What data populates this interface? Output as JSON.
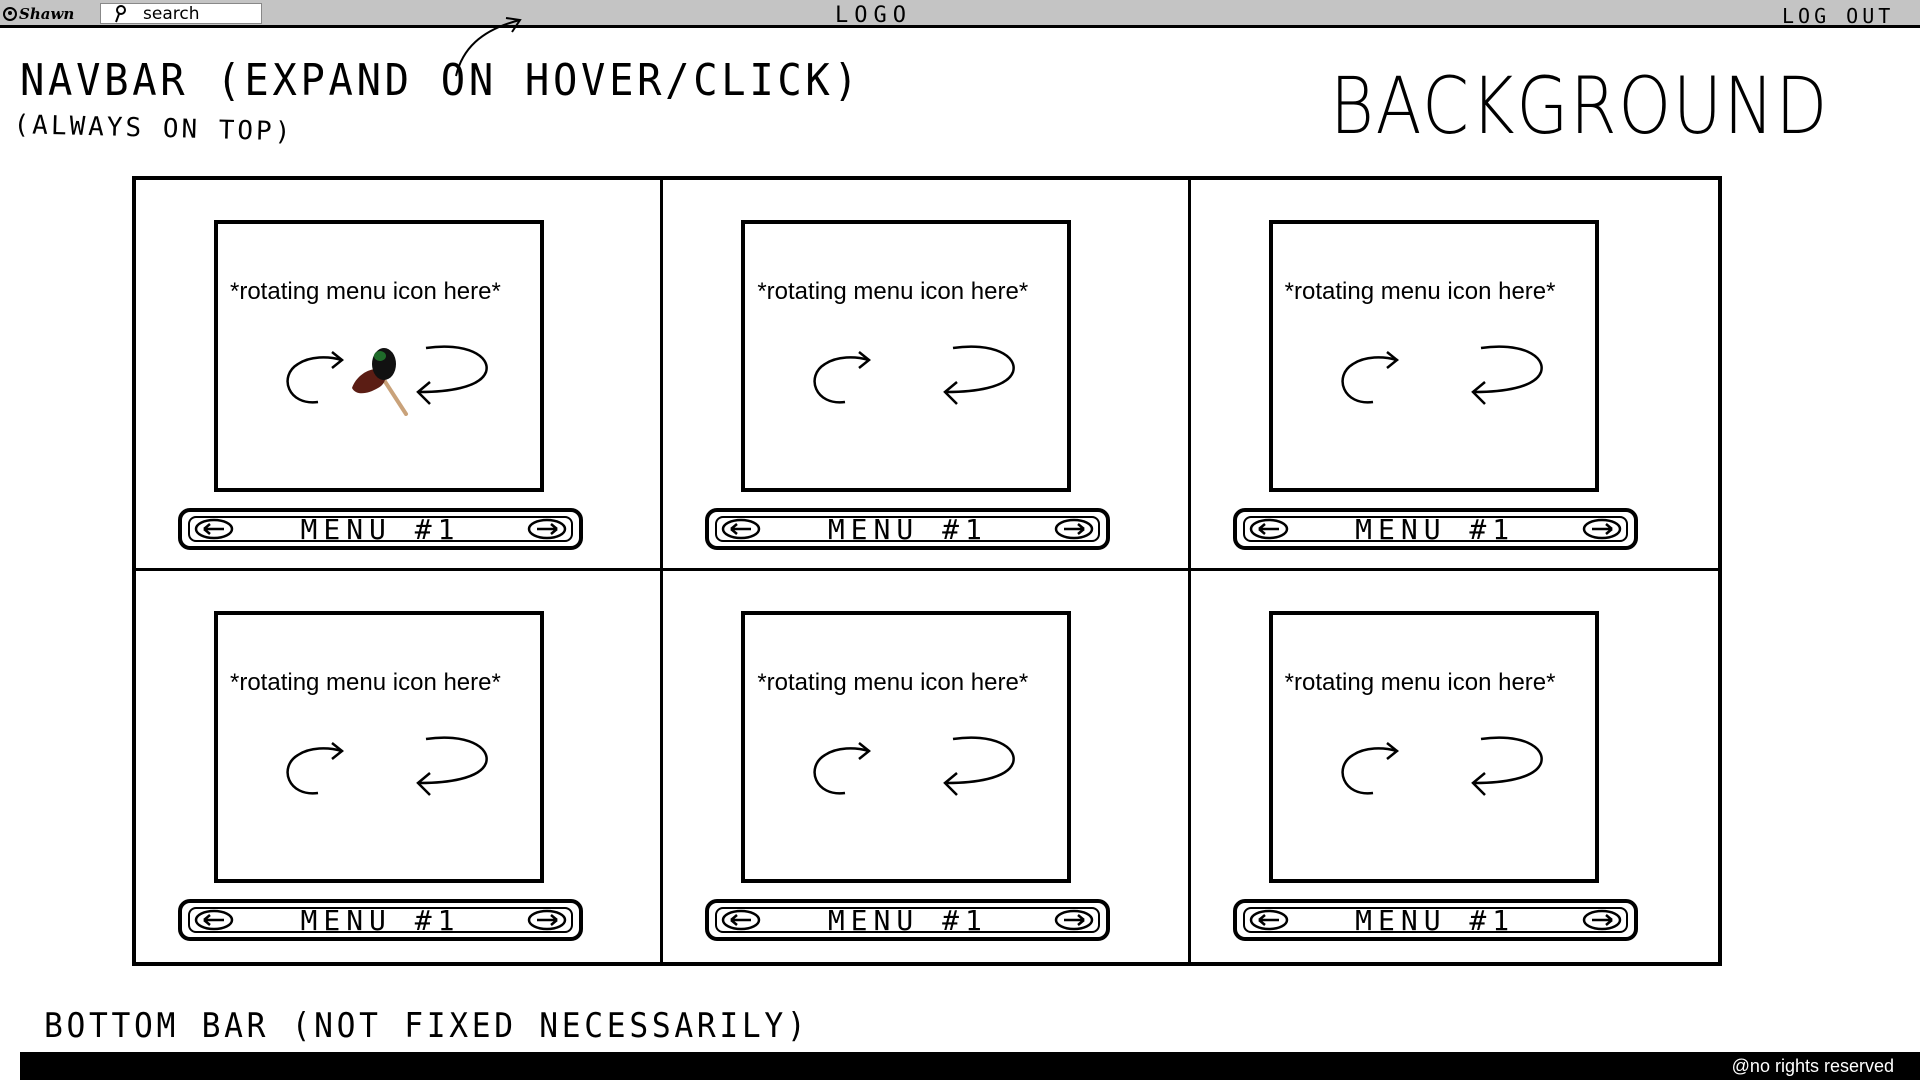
{
  "navbar": {
    "user_name": "Shawn",
    "search_placeholder": "search",
    "logo": "LOGO",
    "logout": "LOG OUT"
  },
  "annotations": {
    "navbar_note": "NAVBAR (EXPAND ON HOVER/CLICK)",
    "always_on_top": "(ALWAYS ON TOP)",
    "background": "BACKGROUND",
    "bottom_bar": "BOTTOM BAR (NOT FIXED NECESSARILY)"
  },
  "tiles": [
    {
      "label": "*rotating menu icon here*",
      "menu": "MENU #1"
    },
    {
      "label": "*rotating menu icon here*",
      "menu": "MENU #1"
    },
    {
      "label": "*rotating menu icon here*",
      "menu": "MENU #1"
    },
    {
      "label": "*rotating menu icon here*",
      "menu": "MENU #1"
    },
    {
      "label": "*rotating menu icon here*",
      "menu": "MENU #1"
    },
    {
      "label": "*rotating menu icon here*",
      "menu": "MENU #1"
    }
  ],
  "footer": {
    "text": "@no rights reserved"
  },
  "icons": {
    "cursor": "hand-cursor-icon",
    "rotate": "curved-arrow-icon",
    "menu_prev": "arrow-left-icon",
    "menu_next": "arrow-right-icon"
  }
}
